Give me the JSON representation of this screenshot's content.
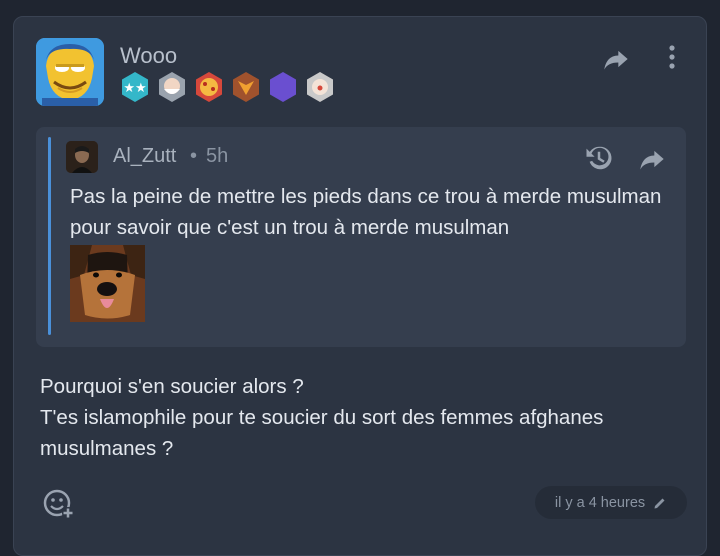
{
  "post": {
    "author": "Wooo",
    "badges": [
      {
        "icon": "stars-badge-icon",
        "color": "#34b7c9"
      },
      {
        "icon": "elder-face-badge-icon",
        "color": "#9aa3ae"
      },
      {
        "icon": "pizza-badge-icon",
        "color": "#d6483b"
      },
      {
        "icon": "fox-badge-icon",
        "color": "#e0a23a"
      },
      {
        "icon": "moon-badge-icon",
        "color": "#6a4fd0"
      },
      {
        "icon": "clown-badge-icon",
        "color": "#c9c9c9"
      }
    ],
    "quote": {
      "author": "Al_Zutt",
      "separator": "•",
      "time": "5h",
      "text": "Pas la peine de mettre les pieds dans ce trou à merde musulman pour savoir que c'est un trou à merde musulman",
      "image_subject": "german-shepherd-dog"
    },
    "reply_lines": [
      "Pourquoi s'en soucier alors ?",
      "T'es islamophile pour te soucier du sort des femmes afghanes musulmanes ?"
    ],
    "timestamp": "il y a 4 heures"
  },
  "colors": {
    "background": "#1f2530",
    "card": "#2c3442",
    "quote_bg": "#353e4e",
    "accent": "#4a90d9",
    "text": "#e4e8ee",
    "muted": "#8a94a2"
  }
}
